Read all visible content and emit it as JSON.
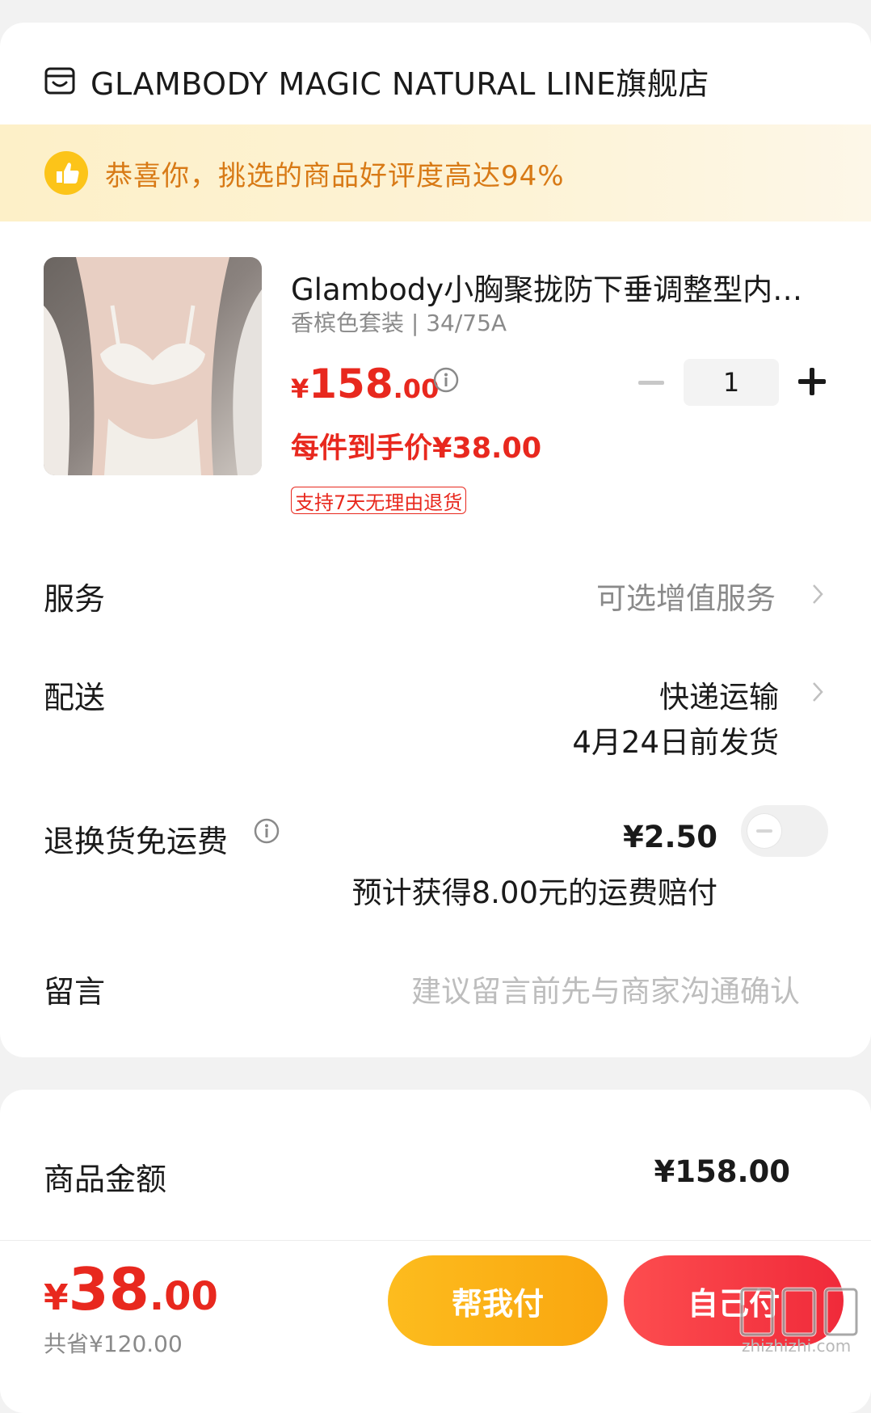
{
  "store": {
    "icon": "store-icon",
    "name": "GLAMBODY MAGIC NATURAL LINE旗舰店"
  },
  "banner": {
    "icon": "thumbs-up-icon",
    "text": "恭喜你，挑选的商品好评度高达94%",
    "color": "#d87a16"
  },
  "product": {
    "title": "Glambody小胸聚拢防下垂调整型内…",
    "spec": "香槟色套装 | 34/75A",
    "price_currency": "¥",
    "price_int": "158",
    "price_dec": ".00",
    "unit_price": "每件到手价¥38.00",
    "return_policy": "支持7天无理由退货",
    "quantity": "1"
  },
  "service": {
    "label": "服务",
    "value": "可选增值服务"
  },
  "delivery": {
    "label": "配送",
    "method": "快递运输",
    "ship_date": "4月24日前发货"
  },
  "return_insurance": {
    "label": "退换货免运费",
    "price": "¥2.50",
    "note": "预计获得8.00元的运费赔付",
    "enabled": false
  },
  "message": {
    "label": "留言",
    "placeholder": "建议留言前先与商家沟通确认"
  },
  "summary": {
    "label": "商品金额",
    "value": "¥158.00"
  },
  "footer": {
    "total_currency": "¥",
    "total_int": "38",
    "total_dec": ".00",
    "saved": "共省¥120.00",
    "help_pay_label": "帮我付",
    "self_pay_label": "自己付",
    "watermark_text": "zhizhizhi.com"
  },
  "colors": {
    "accent_red": "#e8281e",
    "accent_yellow": "#fdbc1e",
    "banner_bg": "#fdf0c8"
  }
}
